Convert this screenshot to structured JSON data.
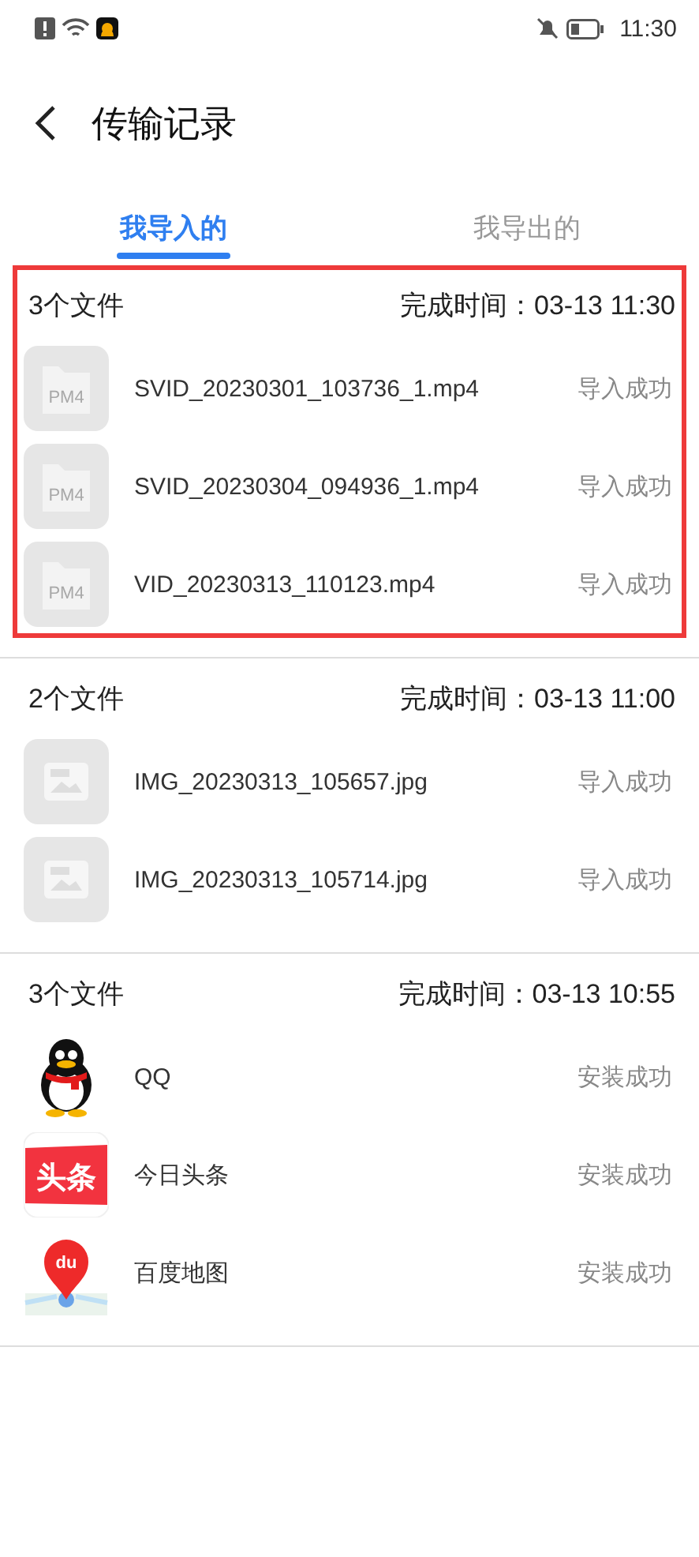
{
  "status_bar": {
    "time": "11:30"
  },
  "header": {
    "title": "传输记录"
  },
  "tabs": [
    {
      "label": "我导入的",
      "selected": true
    },
    {
      "label": "我导出的",
      "selected": false
    }
  ],
  "groups": [
    {
      "count": "3个文件",
      "finished": "完成时间：03-13 11:30",
      "highlighted": true,
      "items": [
        {
          "kind": "video",
          "icon_text": "PM4",
          "name": "SVID_20230301_103736_1.mp4",
          "status": "导入成功"
        },
        {
          "kind": "video",
          "icon_text": "PM4",
          "name": "SVID_20230304_094936_1.mp4",
          "status": "导入成功"
        },
        {
          "kind": "video",
          "icon_text": "PM4",
          "name": "VID_20230313_110123.mp4",
          "status": "导入成功"
        }
      ]
    },
    {
      "count": "2个文件",
      "finished": "完成时间：03-13 11:00",
      "highlighted": false,
      "items": [
        {
          "kind": "image",
          "name": "IMG_20230313_105657.jpg",
          "status": "导入成功"
        },
        {
          "kind": "image",
          "name": "IMG_20230313_105714.jpg",
          "status": "导入成功"
        }
      ]
    },
    {
      "count": "3个文件",
      "finished": "完成时间：03-13 10:55",
      "highlighted": false,
      "items": [
        {
          "kind": "penguin",
          "name": "QQ",
          "status": "安装成功"
        },
        {
          "kind": "news",
          "icon_text": "头条",
          "name": "今日头条",
          "status": "安装成功"
        },
        {
          "kind": "map",
          "icon_text": "du",
          "name": "百度地图",
          "status": "安装成功"
        }
      ]
    }
  ]
}
